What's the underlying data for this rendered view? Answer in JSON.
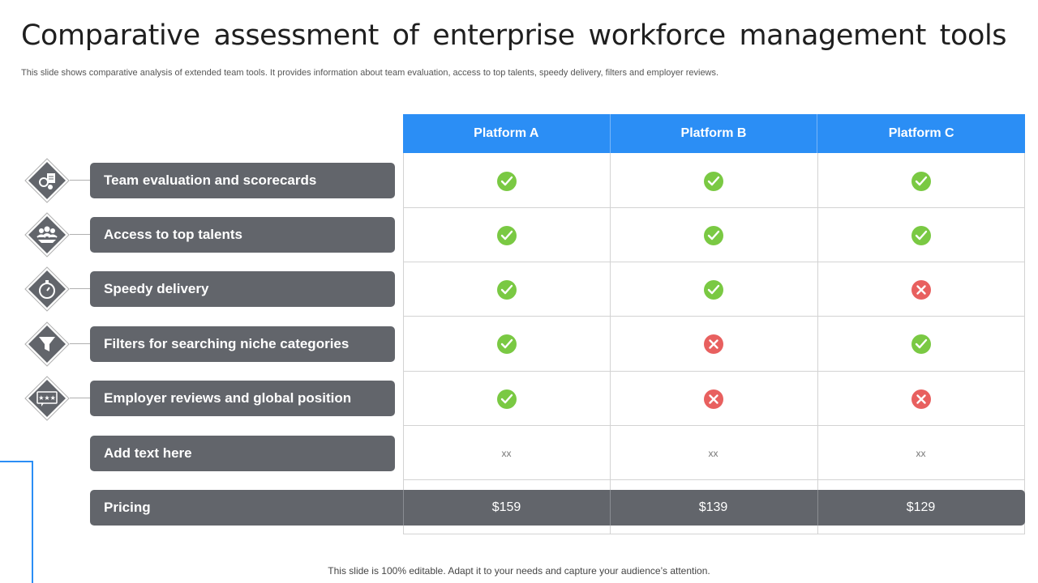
{
  "title": "Comparative assessment of enterprise workforce management tools",
  "subtitle": "This slide shows comparative analysis of extended team tools. It provides information about team evaluation, access to top talents, speedy delivery, filters and employer reviews.",
  "platforms": [
    "Platform A",
    "Platform B",
    "Platform C"
  ],
  "features": [
    {
      "label": "Team evaluation and scorecards",
      "icon": "team-scorecard-icon",
      "values": [
        "check",
        "check",
        "check"
      ]
    },
    {
      "label": "Access to top talents",
      "icon": "talent-group-icon",
      "values": [
        "check",
        "check",
        "check"
      ]
    },
    {
      "label": "Speedy delivery",
      "icon": "stopwatch-icon",
      "values": [
        "check",
        "check",
        "cross"
      ]
    },
    {
      "label": "Filters for searching niche categories",
      "icon": "filter-funnel-icon",
      "values": [
        "check",
        "cross",
        "check"
      ]
    },
    {
      "label": "Employer reviews and global position",
      "icon": "star-rating-icon",
      "values": [
        "check",
        "cross",
        "cross"
      ]
    }
  ],
  "extra_row": {
    "label": "Add text here",
    "values": [
      "xx",
      "xx",
      "xx"
    ]
  },
  "pricing": {
    "label": "Pricing",
    "values": [
      "$159",
      "$139",
      "$129"
    ]
  },
  "footer": "This slide is 100% editable. Adapt it to your needs and capture your audience’s attention.",
  "colors": {
    "header": "#2b8ef5",
    "pill": "#62656b",
    "check": "#7ac943",
    "cross": "#e8605f"
  }
}
